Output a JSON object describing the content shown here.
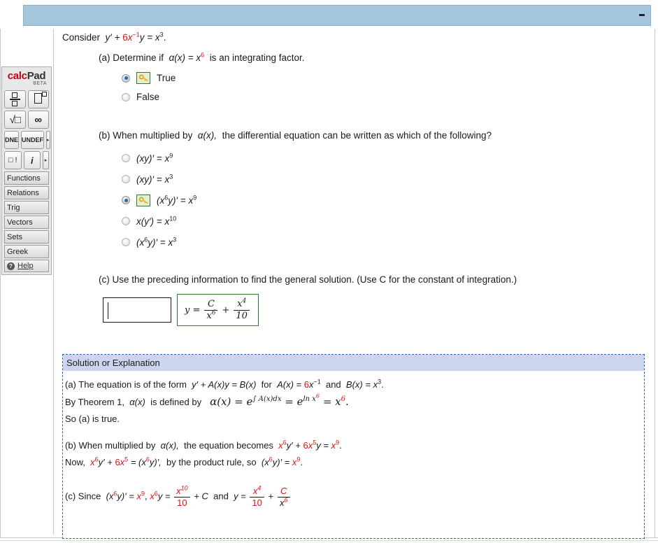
{
  "window": {
    "minimize_label": "minimize"
  },
  "calcpad": {
    "logo_calc": "calc",
    "logo_pad": "Pad",
    "beta": "BETA",
    "buttons": [
      {
        "name": "fraction",
        "label": ""
      },
      {
        "name": "exponent",
        "label": ""
      },
      {
        "name": "square-root",
        "label": "√□"
      },
      {
        "name": "infinity",
        "label": "∞"
      },
      {
        "name": "dne",
        "label": "DNE"
      },
      {
        "name": "undef",
        "label": "UN DEF"
      },
      {
        "name": "factorial",
        "label": "□ !"
      },
      {
        "name": "imaginary",
        "label": "i"
      }
    ],
    "dne_label": "DNE",
    "undef_line1": "UN",
    "undef_line2": "DEF",
    "factorial_label": "□ !",
    "imaginary_label": "i",
    "arrow_glyph": "▸",
    "menus": [
      "Functions",
      "Relations",
      "Trig",
      "Vectors",
      "Sets",
      "Greek"
    ],
    "help_label": "Help",
    "help_icon_glyph": "?"
  },
  "question": {
    "prompt_prefix": "Consider",
    "prompt_equation": {
      "y_prime": "y′ +",
      "coefficient": "6",
      "x_term": "x",
      "x_exp": "−1",
      "y": "y =",
      "rhs": "x",
      "rhs_exp": "3",
      "period": "."
    },
    "parts": {
      "a": {
        "label": "(a)",
        "text_before": "Determine if",
        "alpha": "α(x) =",
        "alpha_base": "x",
        "alpha_exp": "6",
        "text_after": "is an integrating factor.",
        "options": [
          {
            "label": "True",
            "selected": true,
            "has_key": true
          },
          {
            "label": "False",
            "selected": false,
            "has_key": false
          }
        ]
      },
      "b": {
        "label": "(b)",
        "text_before": "When multiplied by",
        "alpha": "α(x),",
        "text_after": "the differential equation can be written as which of the following?",
        "options": [
          {
            "id": "b1",
            "selected": false,
            "has_key": false,
            "math": {
              "lhs_open": "(xy)′ =",
              "rhs_base": "x",
              "rhs_exp": "9"
            }
          },
          {
            "id": "b2",
            "selected": false,
            "has_key": false,
            "math": {
              "lhs_open": "(xy)′ =",
              "rhs_base": "x",
              "rhs_exp": "3"
            }
          },
          {
            "id": "b3",
            "selected": true,
            "has_key": true,
            "math": {
              "lhs_paren_open": "(x",
              "lhs_exp": "6",
              "lhs_rest": "y)′ =",
              "rhs_base": "x",
              "rhs_exp": "9"
            }
          },
          {
            "id": "b4",
            "selected": false,
            "has_key": false,
            "math": {
              "lhs_open": "x(y′) =",
              "rhs_base": "x",
              "rhs_exp": "10"
            }
          },
          {
            "id": "b5",
            "selected": false,
            "has_key": false,
            "math": {
              "lhs_paren_open": "(x",
              "lhs_exp": "6",
              "lhs_rest": "y)′ =",
              "rhs_base": "x",
              "rhs_exp": "3"
            }
          }
        ]
      },
      "c": {
        "label": "(c)",
        "text": "Use the preceding information to find the general solution. (Use C for the constant of integration.)",
        "input_value": "",
        "input_placeholder": "",
        "formula": {
          "y_eq": "y =",
          "frac1_num": "C",
          "frac1_den_base": "x",
          "frac1_den_exp": "6",
          "plus": "+",
          "frac2_num_base": "x",
          "frac2_num_exp": "4",
          "frac2_den": "10"
        }
      }
    }
  },
  "solution": {
    "header": "Solution or Explanation",
    "part_a": {
      "label": "(a)",
      "s1": "The equation is of the form",
      "form_lhs": "y′ + A(x)y = B(x)",
      "s2": "for",
      "ax_eq": "A(x) =",
      "ax_coef": "6",
      "ax_base": "x",
      "ax_exp": "−1",
      "s3": "and",
      "bx_eq": "B(x) =",
      "bx_base": "x",
      "bx_exp": "3",
      "period": ".",
      "line2_pre": "By Theorem 1,",
      "line2_alpha": "α(x)",
      "line2_post": "is defined by",
      "alpha_def_lhs": "α(x) = e",
      "alpha_def_int": "∫ A(x)dx",
      "alpha_def_mid": "= e",
      "alpha_def_ln": "ln x",
      "alpha_def_ln_exp": "6",
      "alpha_def_rhs": "= x",
      "alpha_def_rhs_exp": "6",
      "line3": "So (a) is true."
    },
    "part_b": {
      "label": "(b)",
      "s1": "When multiplied by",
      "alpha": "α(x),",
      "s2": "the equation becomes",
      "eq_x": "x",
      "eq_x_exp": "6",
      "eq_yprime": "y′ +",
      "eq_coef": "6",
      "eq_x2": "x",
      "eq_x2_exp": "5",
      "eq_y": "y =",
      "eq_rhs": "x",
      "eq_rhs_exp": "9",
      "period": ".",
      "line2_pre": "Now,",
      "l2_x": "x",
      "l2_x_exp": "6",
      "l2_yprime": "y′ +",
      "l2_coef": "6",
      "l2_x2": "x",
      "l2_x2_exp": "5",
      "l2_eq": "= (x",
      "l2_eq_exp": "6",
      "l2_eq_rest": "y)′,",
      "line2_mid": "by the product rule, so",
      "l2_final_open": "(x",
      "l2_final_exp": "6",
      "l2_final_rest": "y)′ =",
      "l2_final_rhs": "x",
      "l2_final_rhs_exp": "9"
    },
    "part_c": {
      "label": "(c)",
      "s1": "Since",
      "t1_open": "(x",
      "t1_exp": "6",
      "t1_rest": "y)′ =",
      "t1_rhs": "x",
      "t1_rhs_exp": "9",
      "comma": ",",
      "t2_x": "x",
      "t2_x_exp": "6",
      "t2_y": "y =",
      "frac1_num_base": "x",
      "frac1_num_exp": "10",
      "frac1_den": "10",
      "plus_c": "+ C",
      "and": "and",
      "t3_y": "y =",
      "frac2_num_base": "x",
      "frac2_num_exp": "4",
      "frac2_den": "10",
      "plus": "+",
      "frac3_num": "C",
      "frac3_den_base": "x",
      "frac3_den_exp": "6"
    }
  },
  "colors": {
    "titlebar": "#a6c6de",
    "answer_red": "#e01010",
    "solution_border": "#2e62b8",
    "solution_header_bg": "#ccd4ef",
    "key_border": "#2f7d2f",
    "key_bg": "#e4f0cf",
    "radio_selected": "#1b6fb4"
  }
}
